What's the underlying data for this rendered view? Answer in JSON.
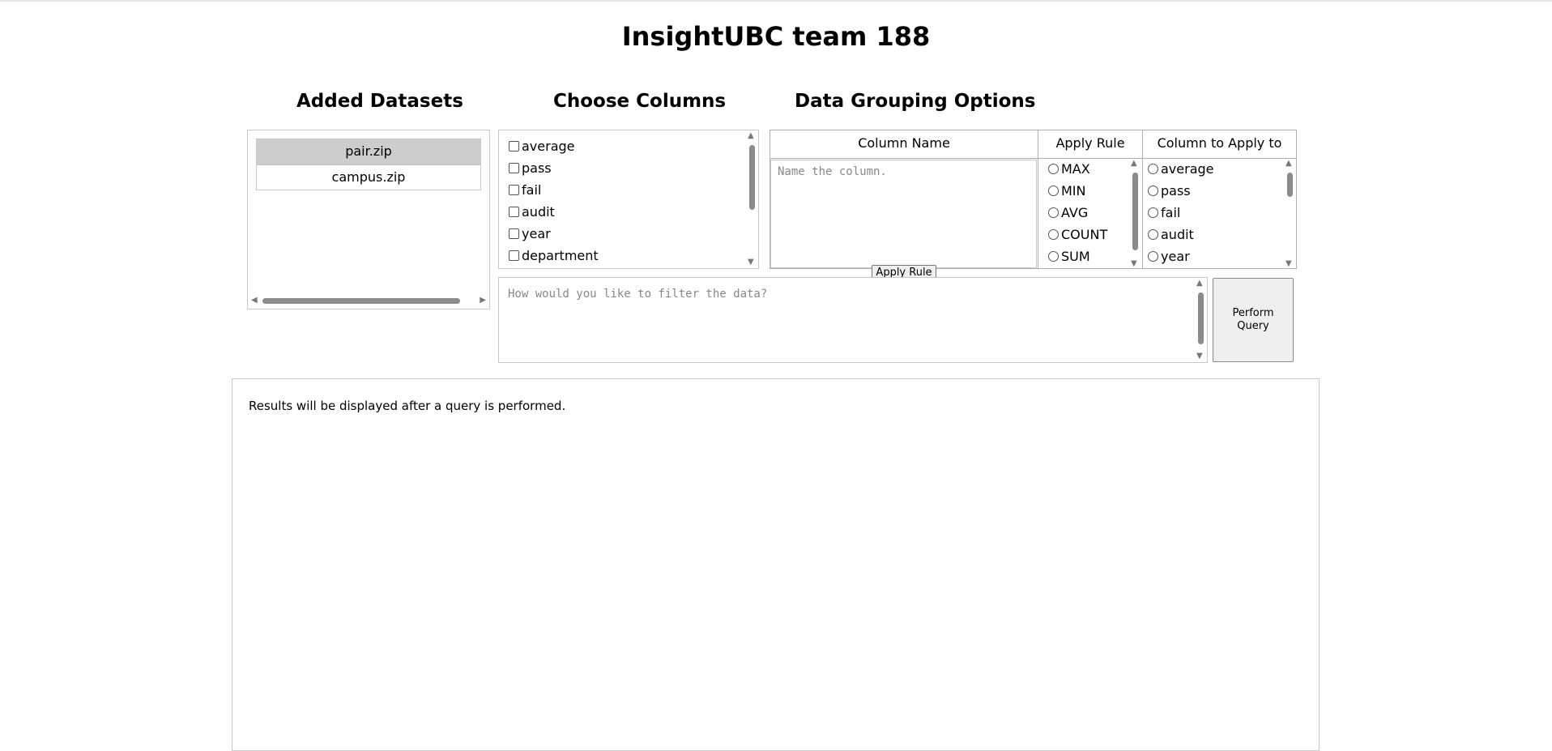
{
  "page": {
    "title": "InsightUBC team 188"
  },
  "sections": {
    "datasets_title": "Added Datasets",
    "columns_title": "Choose Columns",
    "grouping_title": "Data Grouping Options"
  },
  "datasets": [
    "pair.zip",
    "campus.zip"
  ],
  "selected_dataset": "pair.zip",
  "columns": [
    "average",
    "pass",
    "fail",
    "audit",
    "year",
    "department"
  ],
  "grouping": {
    "headers": {
      "column_name": "Column Name",
      "apply_rule": "Apply Rule",
      "column_to_apply": "Column to Apply to"
    },
    "column_name_placeholder": "Name the column.",
    "rules": [
      "MAX",
      "MIN",
      "AVG",
      "COUNT",
      "SUM"
    ],
    "apply_columns": [
      "average",
      "pass",
      "fail",
      "audit",
      "year"
    ],
    "apply_button": "Apply Rule"
  },
  "filter": {
    "placeholder": "How would you like to filter the data?"
  },
  "perform_button": "Perform Query",
  "results": {
    "message": "Results will be displayed after a query is performed."
  }
}
